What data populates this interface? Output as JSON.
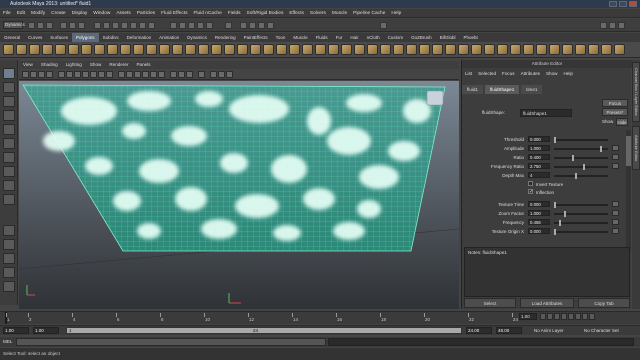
{
  "window": {
    "title": "Autodesk Maya 2013: untitled*    fluid1"
  },
  "menubar": [
    "File",
    "Edit",
    "Modify",
    "Create",
    "Display",
    "Window",
    "Assets",
    "Particles",
    "Fluid Effects",
    "Fluid nCache",
    "Fields",
    "Soft/Rigid Bodies",
    "Effects",
    "Solvers",
    "Muscle",
    "Pipeline Cache",
    "Help"
  ],
  "statusline": {
    "mode": "Dynamics"
  },
  "shelf_tabs": [
    {
      "label": "General"
    },
    {
      "label": "Curves"
    },
    {
      "label": "Surfaces"
    },
    {
      "label": "Polygons",
      "active": true
    },
    {
      "label": "Subdivs"
    },
    {
      "label": "Deformation"
    },
    {
      "label": "Animation"
    },
    {
      "label": "Dynamics"
    },
    {
      "label": "Rendering"
    },
    {
      "label": "PaintEffects"
    },
    {
      "label": "Toon"
    },
    {
      "label": "Muscle"
    },
    {
      "label": "Fluids"
    },
    {
      "label": "Fur"
    },
    {
      "label": "Hair"
    },
    {
      "label": "nCloth"
    },
    {
      "label": "Custom"
    },
    {
      "label": "GoZBrush"
    },
    {
      "label": "BifGlobl"
    },
    {
      "label": "Phoebt"
    }
  ],
  "viewport_menu": [
    "View",
    "Shading",
    "Lighting",
    "Show",
    "Renderer",
    "Panels"
  ],
  "attribute_editor": {
    "title": "Attribute Editor",
    "menu": [
      "List",
      "Selected",
      "Focus",
      "Attributes",
      "Show",
      "Help"
    ],
    "tabs": [
      {
        "label": "fluid1"
      },
      {
        "label": "fluidShape1",
        "active": true
      },
      {
        "label": "time1"
      }
    ],
    "shape_label": "fluidShape:",
    "shape_value": "fluidShape1",
    "focus_btn": "Focus",
    "presets_btn": "Presets*",
    "show_btn": "Show",
    "hide_btn": "Hide",
    "rows": [
      {
        "label": "Threshold",
        "value": "0.000",
        "slider": 0.0
      },
      {
        "label": "Amplitude",
        "value": "1.000",
        "slider": 0.88
      },
      {
        "label": "Ratio",
        "value": "0.400",
        "slider": 0.35
      },
      {
        "label": "Frequency Ratio",
        "value": "2.750",
        "slider": 0.55
      },
      {
        "label": "Depth Max",
        "value": "4",
        "slider": 0.4
      }
    ],
    "checks": [
      {
        "label": "Invert Texture",
        "checked": false
      },
      {
        "label": "Inflection",
        "checked": true
      }
    ],
    "rows2": [
      {
        "label": "Texture Time",
        "value": "0.000",
        "slider": 0.0
      },
      {
        "label": "Zoom Factor",
        "value": "1.000",
        "slider": 0.2
      },
      {
        "label": "Frequency",
        "value": "0.456",
        "slider": 0.1
      },
      {
        "label": "Texture Origin X",
        "value": "0.000",
        "slider": 0.0
      }
    ],
    "notes_label": "Notes: fluidShape1",
    "bottom_buttons": [
      "Select",
      "Load Attributes",
      "Copy Tab"
    ]
  },
  "side_tabs": [
    "Channel Box / Layer Editor",
    "Attribute Editor"
  ],
  "timeslider": {
    "ticks": [
      "1",
      "2",
      "4",
      "6",
      "8",
      "10",
      "12",
      "14",
      "16",
      "18",
      "20",
      "22",
      "24"
    ],
    "current": "1.00"
  },
  "range": {
    "start": "1.00",
    "start2": "1.00",
    "slider_start": "1",
    "slider_end": "24",
    "end": "24.00",
    "end2": "48.00",
    "anim_layer": "No Anim Layer",
    "char_set": "No Character Set"
  },
  "cmdline": {
    "label": "MEL"
  },
  "helpline": {
    "text": "Select Tool: select an object"
  },
  "colors": {
    "fluid_wire": "#5fe6b8",
    "fluid_fill": "#2f9b8a",
    "cloud": "#e6fff6"
  }
}
